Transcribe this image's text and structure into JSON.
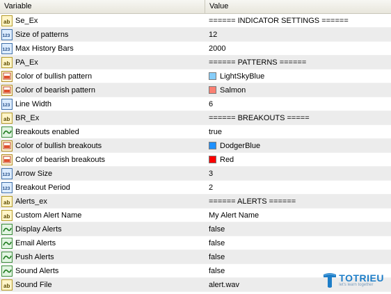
{
  "header": {
    "variable_col": "Variable",
    "value_col": "Value"
  },
  "rows": [
    {
      "name": "Se_Ex",
      "value": "====== INDICATOR SETTINGS ======",
      "icon": "text-ab-icon"
    },
    {
      "name": "Size of patterns",
      "value": "12",
      "icon": "integer-123-icon"
    },
    {
      "name": "Max History Bars",
      "value": "2000",
      "icon": "integer-123-icon"
    },
    {
      "name": "PA_Ex",
      "value": "====== PATTERNS ======",
      "icon": "text-ab-icon"
    },
    {
      "name": "Color of bullish pattern",
      "value": "LightSkyBlue",
      "icon": "color-icon",
      "swatch": "#87CEFA"
    },
    {
      "name": "Color of bearish pattern",
      "value": "Salmon",
      "icon": "color-icon",
      "swatch": "#FA8072"
    },
    {
      "name": "Line Width",
      "value": "6",
      "icon": "integer-123-icon"
    },
    {
      "name": "BR_Ex",
      "value": "====== BREAKOUTS =====",
      "icon": "text-ab-icon"
    },
    {
      "name": "Breakouts enabled",
      "value": "true",
      "icon": "boolean-icon"
    },
    {
      "name": "Color of bullish breakouts",
      "value": "DodgerBlue",
      "icon": "color-icon",
      "swatch": "#1E90FF"
    },
    {
      "name": "Color of bearish breakouts",
      "value": "Red",
      "icon": "color-icon",
      "swatch": "#FF0000"
    },
    {
      "name": "Arrow Size",
      "value": "3",
      "icon": "integer-123-icon"
    },
    {
      "name": "Breakout Period",
      "value": "2",
      "icon": "integer-123-icon"
    },
    {
      "name": "Alerts_ex",
      "value": "====== ALERTS ======",
      "icon": "text-ab-icon"
    },
    {
      "name": "Custom Alert Name",
      "value": "My Alert Name",
      "icon": "text-ab-icon"
    },
    {
      "name": "Display Alerts",
      "value": "false",
      "icon": "boolean-icon"
    },
    {
      "name": "Email Alerts",
      "value": "false",
      "icon": "boolean-icon"
    },
    {
      "name": "Push Alerts",
      "value": "false",
      "icon": "boolean-icon"
    },
    {
      "name": "Sound Alerts",
      "value": "false",
      "icon": "boolean-icon"
    },
    {
      "name": "Sound File",
      "value": "alert.wav",
      "icon": "text-ab-icon"
    }
  ],
  "watermark": {
    "brand": "TOTRIEU",
    "tagline": "let's learn together"
  },
  "colors": {
    "row_alt_bg": "#ececec",
    "header_bg": "#eeede5",
    "brand_blue": "#1e7ec8"
  }
}
